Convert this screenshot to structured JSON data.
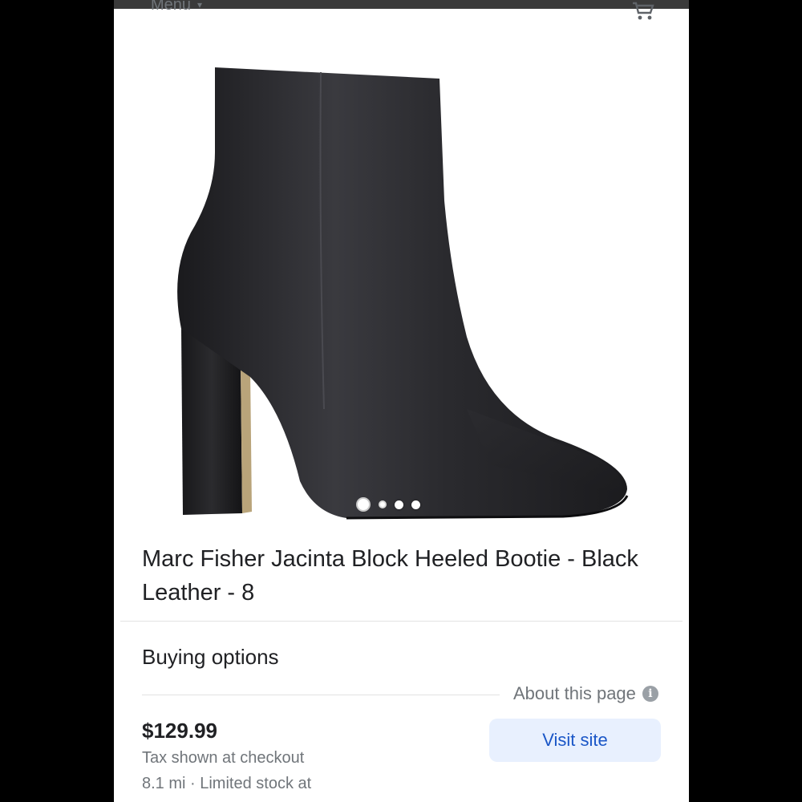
{
  "header": {
    "menu_label": "Menu"
  },
  "product": {
    "title": "Marc Fisher Jacinta Block Heeled Bootie - Black Leather - 8",
    "image_alt": "black leather block heeled ankle boot",
    "carousel_total": 4,
    "carousel_active": 1
  },
  "buying": {
    "section_title": "Buying options",
    "about_label": "About this page",
    "price": "$129.99",
    "tax_note": "Tax shown at checkout",
    "stock_note": "8.1 mi · Limited stock at",
    "visit_label": "Visit site"
  },
  "colors": {
    "accent_button_bg": "#e8f0fe",
    "accent_button_text": "#1a56c7"
  }
}
